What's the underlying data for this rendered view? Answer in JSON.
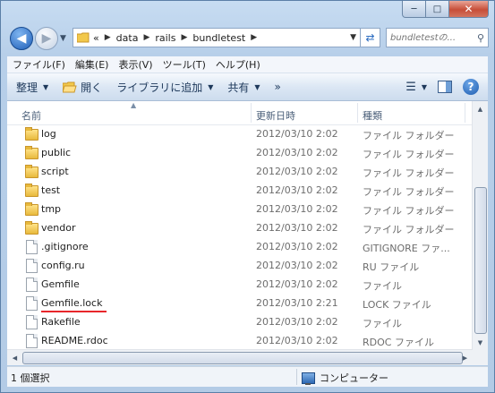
{
  "address": {
    "overflow": "«",
    "crumbs": [
      "data",
      "rails",
      "bundletest"
    ]
  },
  "search": {
    "placeholder": "bundletestの..."
  },
  "menu": [
    "ファイル(F)",
    "編集(E)",
    "表示(V)",
    "ツール(T)",
    "ヘルプ(H)"
  ],
  "toolbar": {
    "organize": "整理",
    "open": "開く",
    "library": "ライブラリに追加",
    "share": "共有",
    "more": "»"
  },
  "columns": {
    "name": "名前",
    "date": "更新日時",
    "type": "種類"
  },
  "files": [
    {
      "name": "log",
      "date": "2012/03/10 2:02",
      "type": "ファイル フォルダー",
      "kind": "folder"
    },
    {
      "name": "public",
      "date": "2012/03/10 2:02",
      "type": "ファイル フォルダー",
      "kind": "folder"
    },
    {
      "name": "script",
      "date": "2012/03/10 2:02",
      "type": "ファイル フォルダー",
      "kind": "folder"
    },
    {
      "name": "test",
      "date": "2012/03/10 2:02",
      "type": "ファイル フォルダー",
      "kind": "folder"
    },
    {
      "name": "tmp",
      "date": "2012/03/10 2:02",
      "type": "ファイル フォルダー",
      "kind": "folder"
    },
    {
      "name": "vendor",
      "date": "2012/03/10 2:02",
      "type": "ファイル フォルダー",
      "kind": "folder"
    },
    {
      "name": ".gitignore",
      "date": "2012/03/10 2:02",
      "type": "GITIGNORE ファ...",
      "kind": "file"
    },
    {
      "name": "config.ru",
      "date": "2012/03/10 2:02",
      "type": "RU ファイル",
      "kind": "file"
    },
    {
      "name": "Gemfile",
      "date": "2012/03/10 2:02",
      "type": "ファイル",
      "kind": "file"
    },
    {
      "name": "Gemfile.lock",
      "date": "2012/03/10 2:21",
      "type": "LOCK ファイル",
      "kind": "file",
      "highlighted": true
    },
    {
      "name": "Rakefile",
      "date": "2012/03/10 2:02",
      "type": "ファイル",
      "kind": "file"
    },
    {
      "name": "README.rdoc",
      "date": "2012/03/10 2:02",
      "type": "RDOC ファイル",
      "kind": "file"
    }
  ],
  "status": {
    "selected": "1 個選択",
    "location": "コンピューター"
  },
  "colors": {
    "highlight_underline": "#e8262b",
    "folder": "#f2c84b"
  }
}
